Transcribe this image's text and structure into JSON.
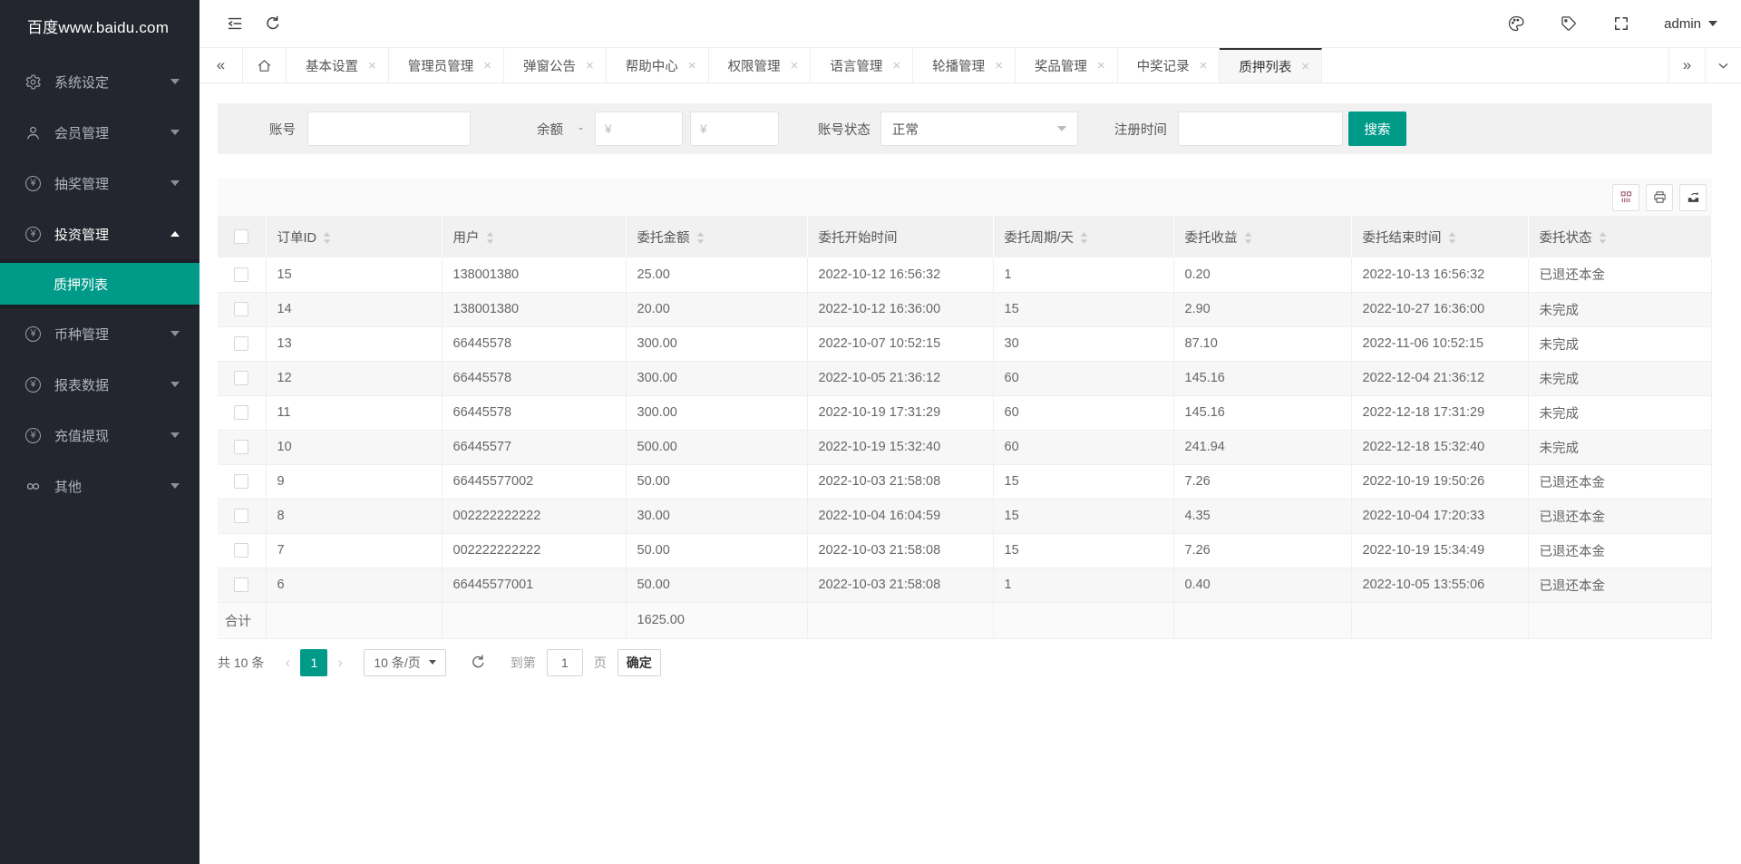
{
  "colors": {
    "accent": "#009a89",
    "sidebar_bg": "#23262e"
  },
  "brand": {
    "logo_text": "百度www.baidu.com"
  },
  "topbar": {
    "username": "admin"
  },
  "sidebar": {
    "items": [
      {
        "label": "系统设定",
        "icon": "gear-icon"
      },
      {
        "label": "会员管理",
        "icon": "user-icon"
      },
      {
        "label": "抽奖管理",
        "icon": "yen-circle-icon"
      },
      {
        "label": "投资管理",
        "icon": "yen-circle-icon",
        "expanded": true,
        "children": [
          {
            "label": "质押列表",
            "active": true
          }
        ]
      },
      {
        "label": "币种管理",
        "icon": "yen-circle-icon"
      },
      {
        "label": "报表数据",
        "icon": "yen-circle-icon"
      },
      {
        "label": "充值提现",
        "icon": "yen-circle-icon"
      },
      {
        "label": "其他",
        "icon": "link-icon"
      }
    ]
  },
  "tabbar": {
    "tabs": [
      {
        "label": "基本设置"
      },
      {
        "label": "管理员管理"
      },
      {
        "label": "弹窗公告"
      },
      {
        "label": "帮助中心"
      },
      {
        "label": "权限管理"
      },
      {
        "label": "语言管理"
      },
      {
        "label": "轮播管理"
      },
      {
        "label": "奖品管理"
      },
      {
        "label": "中奖记录"
      },
      {
        "label": "质押列表",
        "active": true
      }
    ]
  },
  "filters": {
    "account_label": "账号",
    "balance_label": "余额",
    "balance_separator": "-",
    "balance_min_placeholder": "¥",
    "balance_max_placeholder": "¥",
    "status_label": "账号状态",
    "status_value": "正常",
    "regtime_label": "注册时间",
    "search_button": "搜索"
  },
  "table": {
    "columns": [
      {
        "label": "订单ID",
        "sortable": true
      },
      {
        "label": "用户",
        "sortable": true
      },
      {
        "label": "委托金额",
        "sortable": true
      },
      {
        "label": "委托开始时间",
        "sortable": false
      },
      {
        "label": "委托周期/天",
        "sortable": true
      },
      {
        "label": "委托收益",
        "sortable": true
      },
      {
        "label": "委托结束时间",
        "sortable": true
      },
      {
        "label": "委托状态",
        "sortable": true
      }
    ],
    "rows": [
      [
        "15",
        "138001380",
        "25.00",
        "2022-10-12 16:56:32",
        "1",
        "0.20",
        "2022-10-13 16:56:32",
        "已退还本金"
      ],
      [
        "14",
        "138001380",
        "20.00",
        "2022-10-12 16:36:00",
        "15",
        "2.90",
        "2022-10-27 16:36:00",
        "未完成"
      ],
      [
        "13",
        "66445578",
        "300.00",
        "2022-10-07 10:52:15",
        "30",
        "87.10",
        "2022-11-06 10:52:15",
        "未完成"
      ],
      [
        "12",
        "66445578",
        "300.00",
        "2022-10-05 21:36:12",
        "60",
        "145.16",
        "2022-12-04 21:36:12",
        "未完成"
      ],
      [
        "11",
        "66445578",
        "300.00",
        "2022-10-19 17:31:29",
        "60",
        "145.16",
        "2022-12-18 17:31:29",
        "未完成"
      ],
      [
        "10",
        "66445577",
        "500.00",
        "2022-10-19 15:32:40",
        "60",
        "241.94",
        "2022-12-18 15:32:40",
        "未完成"
      ],
      [
        "9",
        "66445577002",
        "50.00",
        "2022-10-03 21:58:08",
        "15",
        "7.26",
        "2022-10-19 19:50:26",
        "已退还本金"
      ],
      [
        "8",
        "002222222222",
        "30.00",
        "2022-10-04 16:04:59",
        "15",
        "4.35",
        "2022-10-04 17:20:33",
        "已退还本金"
      ],
      [
        "7",
        "002222222222",
        "50.00",
        "2022-10-03 21:58:08",
        "15",
        "7.26",
        "2022-10-19 15:34:49",
        "已退还本金"
      ],
      [
        "6",
        "66445577001",
        "50.00",
        "2022-10-03 21:58:08",
        "1",
        "0.40",
        "2022-10-05 13:55:06",
        "已退还本金"
      ]
    ],
    "summary": {
      "label": "合计",
      "total_amount": "1625.00"
    }
  },
  "pagination": {
    "total_text": "共 10 条",
    "current_page": "1",
    "page_size_text": "10 条/页",
    "goto_label": "到第",
    "goto_value": "1",
    "page_unit": "页",
    "confirm_button": "确定"
  }
}
